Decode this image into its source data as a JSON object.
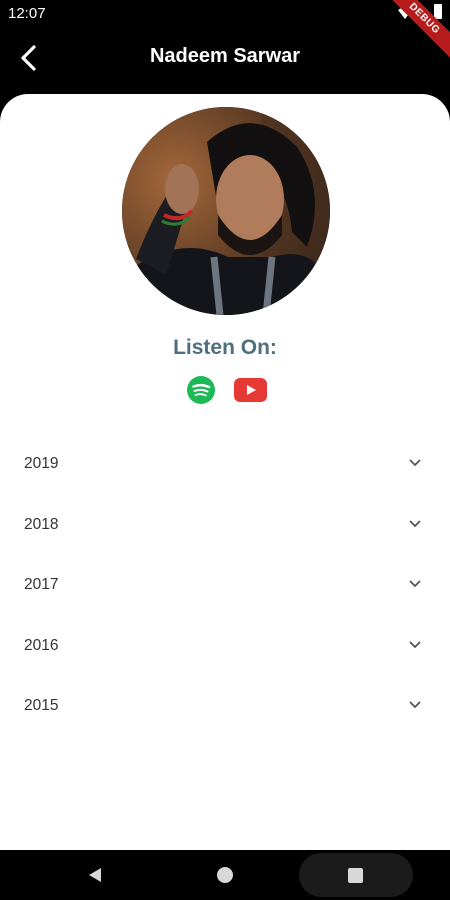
{
  "status_bar": {
    "time": "12:07",
    "debug_label": "DEBUG"
  },
  "app_bar": {
    "title": "Nadeem Sarwar",
    "back_icon": "arrow-back-icon"
  },
  "profile": {
    "avatar_alt": "Nadeem Sarwar"
  },
  "listen": {
    "label": "Listen On:",
    "platforms": [
      {
        "icon": "spotify-icon",
        "color": "#1db954"
      },
      {
        "icon": "youtube-icon",
        "color": "#e53935"
      }
    ]
  },
  "years": [
    {
      "label": "2019"
    },
    {
      "label": "2018"
    },
    {
      "label": "2017"
    },
    {
      "label": "2016"
    },
    {
      "label": "2015"
    }
  ],
  "nav_bar": {
    "icons": [
      "back-triangle-icon",
      "home-circle-icon",
      "recents-square-icon"
    ]
  },
  "colors": {
    "background": "#000000",
    "card": "#ffffff",
    "accent_text": "#4f6f7f",
    "debug_banner": "#b71c1c"
  }
}
